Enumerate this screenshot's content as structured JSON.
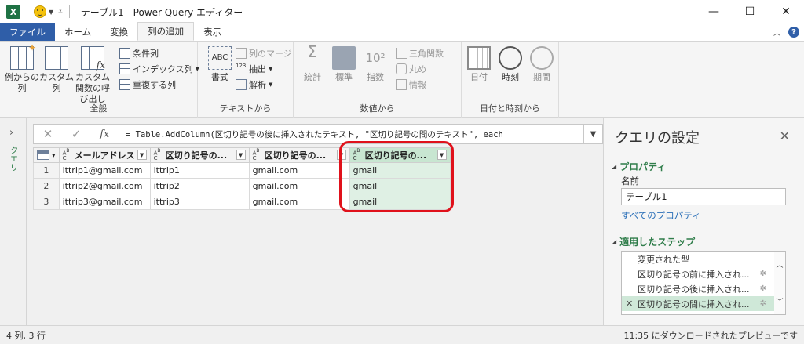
{
  "window": {
    "title": "テーブル1 - Power Query エディター",
    "logo": "X"
  },
  "tabs": [
    {
      "label": "ファイル"
    },
    {
      "label": "ホーム"
    },
    {
      "label": "変換"
    },
    {
      "label": "列の追加"
    },
    {
      "label": "表示"
    }
  ],
  "ribbon": {
    "general": {
      "example_col": "例からの列",
      "custom_col": "カスタム列",
      "invoke_custom": "カスタム関数の呼び出し",
      "conditional_col": "条件列",
      "index_col": "インデックス列",
      "duplicate_col": "重複する列",
      "label": "全般"
    },
    "text": {
      "format": "書式",
      "merge": "列のマージ",
      "extract": "抽出",
      "parse": "解析",
      "abc": "ABC",
      "num_glyph": "123",
      "label": "テキストから"
    },
    "number": {
      "stats": "統計",
      "standard": "標準",
      "scientific": "指数",
      "trig": "三角関数",
      "round": "丸め",
      "info": "情報",
      "label": "数値から",
      "sigma": "Σ",
      "sci_glyph": "10²"
    },
    "datetime": {
      "date": "日付",
      "time": "時刻",
      "duration": "期間",
      "label": "日付と時刻から"
    }
  },
  "sidebar_collapsed": {
    "label": "クエリ",
    "chevron": "›"
  },
  "formula_bar": {
    "cancel": "✕",
    "commit": "✓",
    "fx": "fx",
    "text": "= Table.AddColumn(区切り記号の後に挿入されたテキスト, \"区切り記号の間のテキスト\", each"
  },
  "table": {
    "columns": [
      {
        "name": "メールアドレス"
      },
      {
        "name": "区切り記号の..."
      },
      {
        "name": "区切り記号の..."
      },
      {
        "name": "区切り記号の..."
      }
    ],
    "rows": [
      {
        "n": "1",
        "cells": [
          "ittrip1@gmail.com",
          "ittrip1",
          "gmail.com",
          "gmail"
        ]
      },
      {
        "n": "2",
        "cells": [
          "ittrip2@gmail.com",
          "ittrip2",
          "gmail.com",
          "gmail"
        ]
      },
      {
        "n": "3",
        "cells": [
          "ittrip3@gmail.com",
          "ittrip3",
          "gmail.com",
          "gmail"
        ]
      }
    ]
  },
  "settings": {
    "title": "クエリの設定",
    "properties_header": "プロパティ",
    "name_label": "名前",
    "name_value": "テーブル1",
    "all_properties_link": "すべてのプロパティ",
    "steps_header": "適用したステップ",
    "steps": [
      {
        "label": "変更された型"
      },
      {
        "label": "区切り記号の前に挿入され..."
      },
      {
        "label": "区切り記号の後に挿入され..."
      },
      {
        "label": "区切り記号の間に挿入され..."
      }
    ]
  },
  "status": {
    "left": "4 列, 3 行",
    "right": "11:35 にダウンロードされたプレビューです"
  },
  "colors": {
    "accent_green": "#2f7d4a",
    "file_tab": "#2f5ea8",
    "highlight": "#e0111b",
    "selected_col": "#dff0e4"
  }
}
